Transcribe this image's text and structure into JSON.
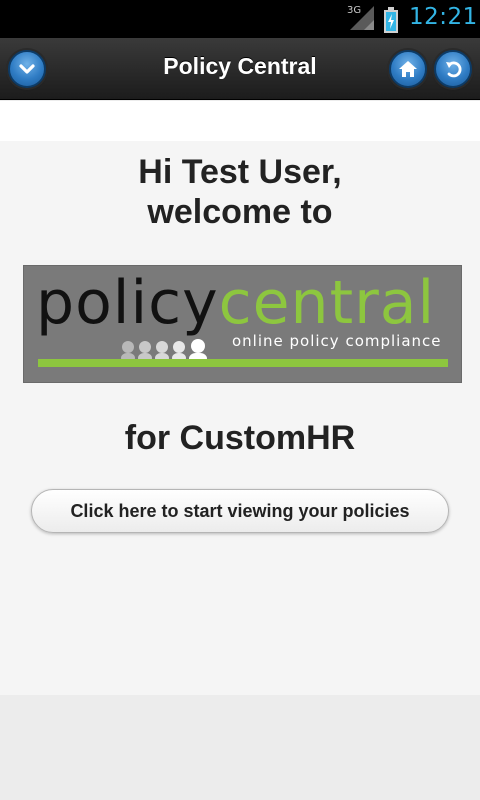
{
  "status_bar": {
    "network": "3G",
    "time": "12:21",
    "time_color": "#33b5e5",
    "signal_icon": "signal-icon",
    "battery_icon": "battery-charging-icon"
  },
  "header": {
    "title": "Policy Central",
    "menu_icon": "chevron-down-icon",
    "home_icon": "home-icon",
    "back_icon": "refresh-back-icon",
    "button_color": "#2f7cc4"
  },
  "main": {
    "greeting_line1": "Hi Test User,",
    "greeting_line2": "welcome to",
    "logo": {
      "word_policy": "policy",
      "word_central": "central",
      "tagline": "online policy compliance",
      "accent_color": "#8dc63f"
    },
    "company_line": "for CustomHR",
    "start_button_label": "Click here to start viewing your policies"
  }
}
